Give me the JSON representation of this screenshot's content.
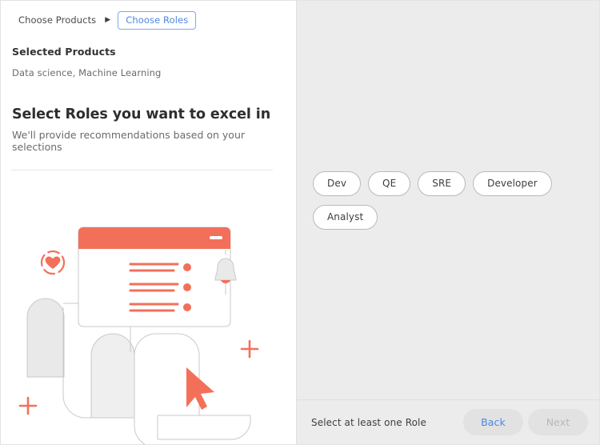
{
  "breadcrumb": {
    "step_previous": "Choose Products",
    "separator_icon": "triangle-right-icon",
    "step_current": "Choose Roles"
  },
  "selected_products": {
    "label": "Selected Products",
    "value": "Data science, Machine Learning"
  },
  "heading": {
    "title": "Select Roles you want to excel in",
    "subtitle": "We'll provide recommendations based on your selections"
  },
  "roles": [
    {
      "label": "Dev"
    },
    {
      "label": "QE"
    },
    {
      "label": "SRE"
    },
    {
      "label": "Developer"
    },
    {
      "label": "Analyst"
    }
  ],
  "footer": {
    "message": "Select at least one Role",
    "back_label": "Back",
    "next_label": "Next"
  },
  "illustration": {
    "name": "onboarding-illustration",
    "elements": [
      "browser-window",
      "heart-in-dashed-circle-icon",
      "bell-icon",
      "cursor-arrow-icon",
      "plus-mark-icon",
      "abstract-rounded-shapes"
    ]
  },
  "colors": {
    "accent_orange": "#F2705A",
    "accent_blue": "#4F86E0",
    "panel_gray": "#ECECEC",
    "shape_gray": "#E3E3E3",
    "border_gray": "#B9B9B9"
  }
}
